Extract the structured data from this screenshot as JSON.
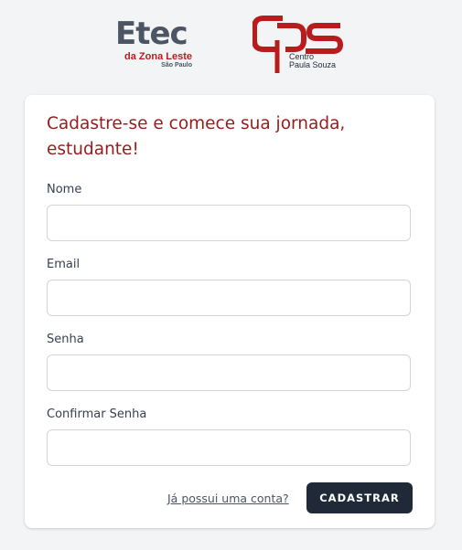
{
  "logos": {
    "etec_name": "Etec",
    "etec_unit": "da Zona Leste",
    "etec_city": "São Paulo",
    "cps_line1": "Centro",
    "cps_line2": "Paula Souza"
  },
  "form": {
    "title": "Cadastre-se e comece sua jornada, estudante!",
    "fields": [
      {
        "label": "Nome",
        "value": "",
        "placeholder": ""
      },
      {
        "label": "Email",
        "value": "",
        "placeholder": ""
      },
      {
        "label": "Senha",
        "value": "",
        "placeholder": ""
      },
      {
        "label": "Confirmar Senha",
        "value": "",
        "placeholder": ""
      }
    ],
    "login_link": "Já possui uma conta?",
    "submit_label": "CADASTRAR"
  },
  "colors": {
    "brand_red": "#991b1b",
    "dark_button": "#1f2937",
    "background": "#f3f4f6"
  }
}
